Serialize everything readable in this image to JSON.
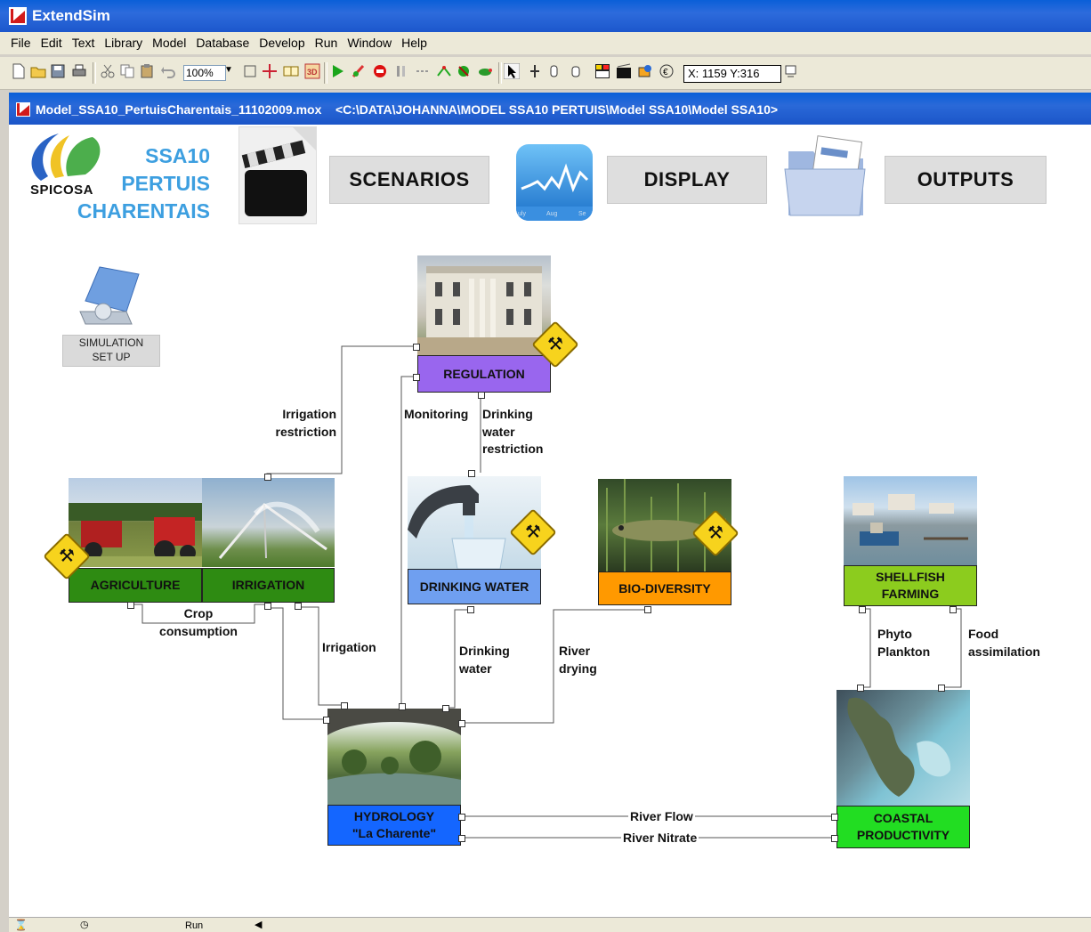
{
  "app": {
    "title": "ExtendSim"
  },
  "menu": [
    "File",
    "Edit",
    "Text",
    "Library",
    "Model",
    "Database",
    "Develop",
    "Run",
    "Window",
    "Help"
  ],
  "toolbar": {
    "zoom": "100%",
    "coords": "X: 1159 Y:316"
  },
  "document": {
    "title": "Model_SSA10_PertuisCharentais_11102009.mox    <C:\\DATA\\JOHANNA\\MODEL SSA10 PERTUIS\\Model SSA10\\Model SSA10>"
  },
  "header": {
    "logo_text": "SPICOSA",
    "ssa_lines": [
      "SSA10",
      "PERTUIS",
      "CHARENTAIS"
    ],
    "scenarios": "SCENARIOS",
    "display": "DISPLAY",
    "outputs": "OUTPUTS",
    "chart_ticks": [
      "uly",
      "Aug",
      "Se"
    ]
  },
  "simulation_setup": {
    "label_line1": "SIMULATION",
    "label_line2": "SET UP"
  },
  "nodes": {
    "regulation": "REGULATION",
    "agriculture": "AGRICULTURE",
    "irrigation": "IRRIGATION",
    "drinking_water": "DRINKING WATER",
    "biodiversity": "BIO-DIVERSITY",
    "shellfish_line1": "SHELLFISH",
    "shellfish_line2": "FARMING",
    "hydrology_line1": "HYDROLOGY",
    "hydrology_line2": "\"La Charente\"",
    "coastal_line1": "COASTAL",
    "coastal_line2": "PRODUCTIVITY"
  },
  "links": {
    "irrigation_restriction": [
      "Irrigation",
      "restriction"
    ],
    "monitoring": "Monitoring",
    "drinking_water_restriction": [
      "Drinking",
      "water",
      "restriction"
    ],
    "crop_consumption": [
      "Crop",
      "consumption"
    ],
    "irrigation": "Irrigation",
    "drinking_water": [
      "Drinking",
      "water"
    ],
    "river_drying": [
      "River",
      "drying"
    ],
    "phyto_plankton": [
      "Phyto",
      "Plankton"
    ],
    "food_assimilation": [
      "Food",
      "assimilation"
    ],
    "river_flow": "River Flow",
    "river_nitrate": "River Nitrate"
  },
  "statusbar": {
    "run": "Run"
  },
  "colors": {
    "regulation": "#9966ee",
    "agriculture": "#2e8b12",
    "drinking_water": "#6f9ff0",
    "biodiversity": "#ff9900",
    "shellfish": "#8ccc1e",
    "hydrology": "#1466ff",
    "coastal": "#22dd22"
  }
}
